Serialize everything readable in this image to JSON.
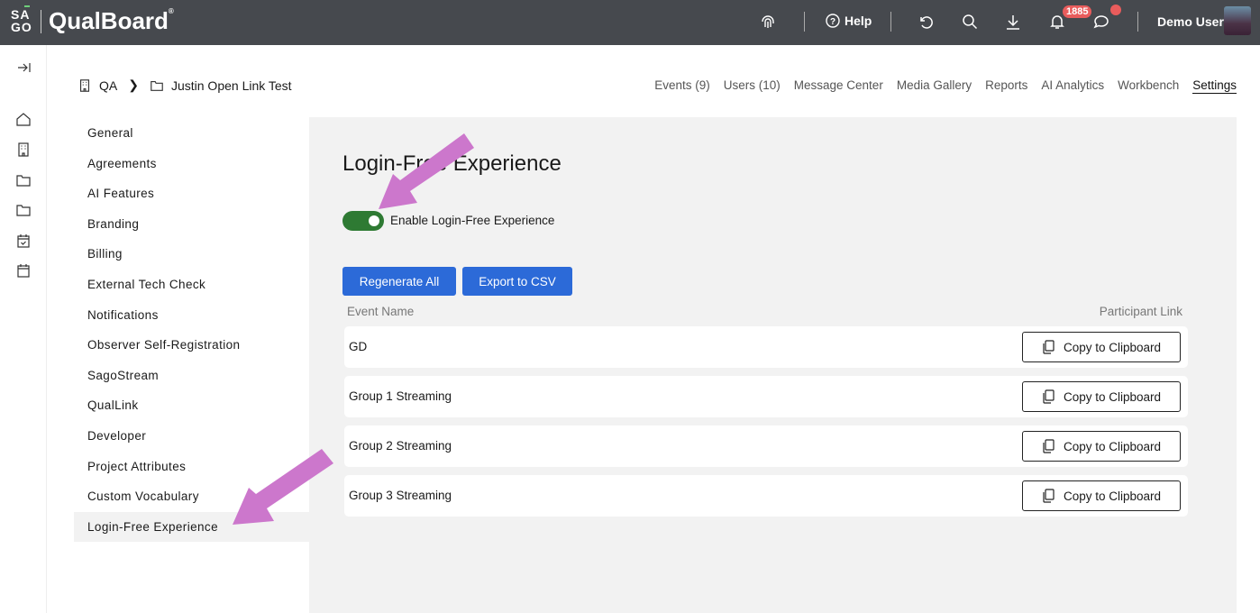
{
  "header": {
    "logo_mark": "SAGO",
    "app_name": "QualBoard",
    "help_label": "Help",
    "notification_count": "1885",
    "user_name": "Demo User"
  },
  "breadcrumb": {
    "org": "QA",
    "project": "Justin Open Link Test"
  },
  "tabs": [
    {
      "label": "Events (9)"
    },
    {
      "label": "Users (10)"
    },
    {
      "label": "Message Center"
    },
    {
      "label": "Media Gallery"
    },
    {
      "label": "Reports"
    },
    {
      "label": "AI Analytics"
    },
    {
      "label": "Workbench"
    },
    {
      "label": "Settings",
      "active": true
    }
  ],
  "settings_nav": [
    {
      "label": "General"
    },
    {
      "label": "Agreements"
    },
    {
      "label": "AI Features"
    },
    {
      "label": "Branding"
    },
    {
      "label": "Billing"
    },
    {
      "label": "External Tech Check"
    },
    {
      "label": "Notifications"
    },
    {
      "label": "Observer Self-Registration"
    },
    {
      "label": "SagoStream"
    },
    {
      "label": "QualLink"
    },
    {
      "label": "Developer"
    },
    {
      "label": "Project Attributes"
    },
    {
      "label": "Custom Vocabulary"
    },
    {
      "label": "Login-Free Experience",
      "active": true
    }
  ],
  "main": {
    "title": "Login-Free Experience",
    "toggle_label": "Enable Login-Free Experience",
    "toggle_on": true,
    "regenerate_label": "Regenerate All",
    "export_label": "Export to CSV",
    "col_event": "Event Name",
    "col_link": "Participant Link",
    "rows": [
      {
        "name": "GD",
        "action": "Copy to Clipboard"
      },
      {
        "name": "Group 1 Streaming",
        "action": "Copy to Clipboard"
      },
      {
        "name": "Group 2 Streaming",
        "action": "Copy to Clipboard"
      },
      {
        "name": "Group 3 Streaming",
        "action": "Copy to Clipboard"
      }
    ]
  },
  "colors": {
    "topbar": "#46494e",
    "primary": "#2c6ad8",
    "toggle_on": "#2e7a33",
    "badge": "#e95c5c",
    "annotation_arrow": "#cc77cc"
  }
}
